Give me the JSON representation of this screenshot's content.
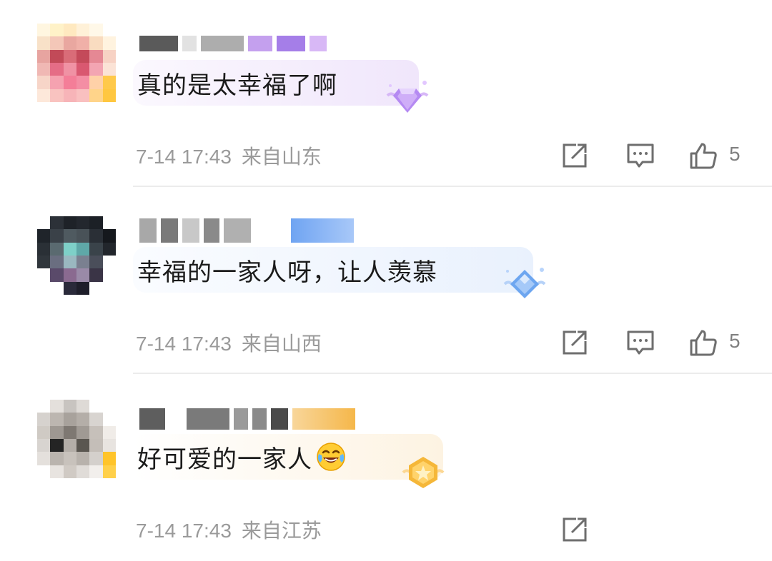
{
  "comments": [
    {
      "text": "真的是太幸福了啊",
      "time": "7-14 17:43",
      "location": "来自山东",
      "likes": "5",
      "badge_icon": "purple-gem-badge-icon",
      "bubble_color": "#f4eefb"
    },
    {
      "text": "幸福的一家人呀，让人羡慕",
      "time": "7-14 17:43",
      "location": "来自山西",
      "likes": "5",
      "badge_icon": "blue-diamond-badge-icon",
      "bubble_color": "#edf3fd"
    },
    {
      "text": "好可爱的一家人",
      "time": "7-14 17:43",
      "location": "来自江苏",
      "likes": "",
      "badge_icon": "gold-star-badge-icon",
      "bubble_color": "#fdf6ea"
    }
  ],
  "icons": {
    "share": "share-icon",
    "reply": "comment-icon",
    "like": "thumbs-up-icon",
    "laugh_emoji": "tears-of-joy-emoji-icon"
  },
  "colors": {
    "text": "#1b1b1b",
    "meta": "#9a9a9a",
    "icon": "#6e6e6e"
  }
}
